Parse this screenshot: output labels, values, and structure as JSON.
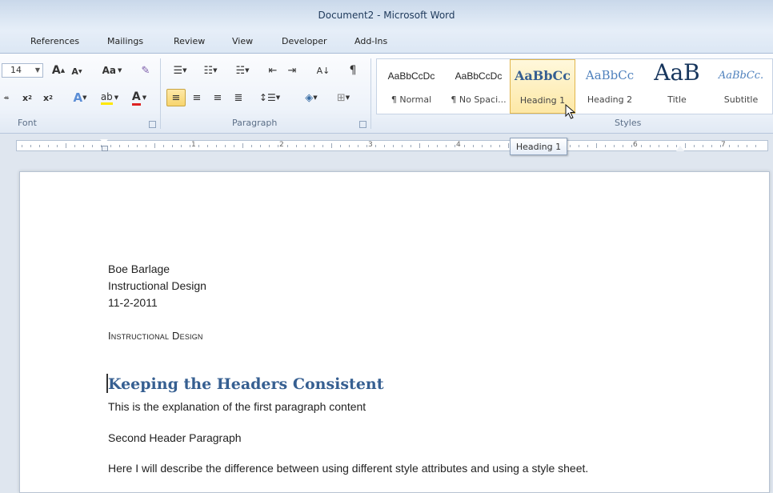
{
  "window": {
    "title": "Document2 - Microsoft Word"
  },
  "tabs": [
    "References",
    "Mailings",
    "Review",
    "View",
    "Developer",
    "Add-Ins"
  ],
  "font_group": {
    "size_value": "14",
    "label": "Font",
    "grow_label": "A",
    "shrink_label": "A",
    "change_case_label": "Aa",
    "subscript_label": "x",
    "superscript_label": "x",
    "font_color_label": "A",
    "strike_label": "abc"
  },
  "paragraph_group": {
    "label": "Paragraph",
    "show_marks_label": "¶",
    "sort_label": "A↓"
  },
  "styles_group": {
    "label": "Styles",
    "styles": [
      {
        "preview": "AaBbCcDc",
        "name": "¶ Normal"
      },
      {
        "preview": "AaBbCcDc",
        "name": "¶ No Spaci..."
      },
      {
        "preview": "AaBbCc",
        "name": "Heading 1"
      },
      {
        "preview": "AaBbCc",
        "name": "Heading 2"
      },
      {
        "preview": "AaB",
        "name": "Title"
      },
      {
        "preview": "AaBbCc.",
        "name": "Subtitle"
      }
    ]
  },
  "tooltip": "Heading 1",
  "ruler": {
    "numbers": [
      "1",
      "2",
      "3",
      "4",
      "6",
      "7"
    ]
  },
  "document": {
    "lines": {
      "name": "Boe Barlage",
      "dept": "Instructional Design",
      "date": "11-2-2011",
      "caps_title": "Instructional Design",
      "heading": "Keeping the Headers Consistent",
      "para1": "This is the explanation of the first paragraph content",
      "para2": "Second Header Paragraph",
      "para3": "Here I will describe the difference between using different style attributes and using a style sheet."
    }
  },
  "colors": {
    "heading_blue": "#365f91",
    "highlight_gold": "#f7d56d",
    "ribbon_border": "#b7c7dc"
  }
}
